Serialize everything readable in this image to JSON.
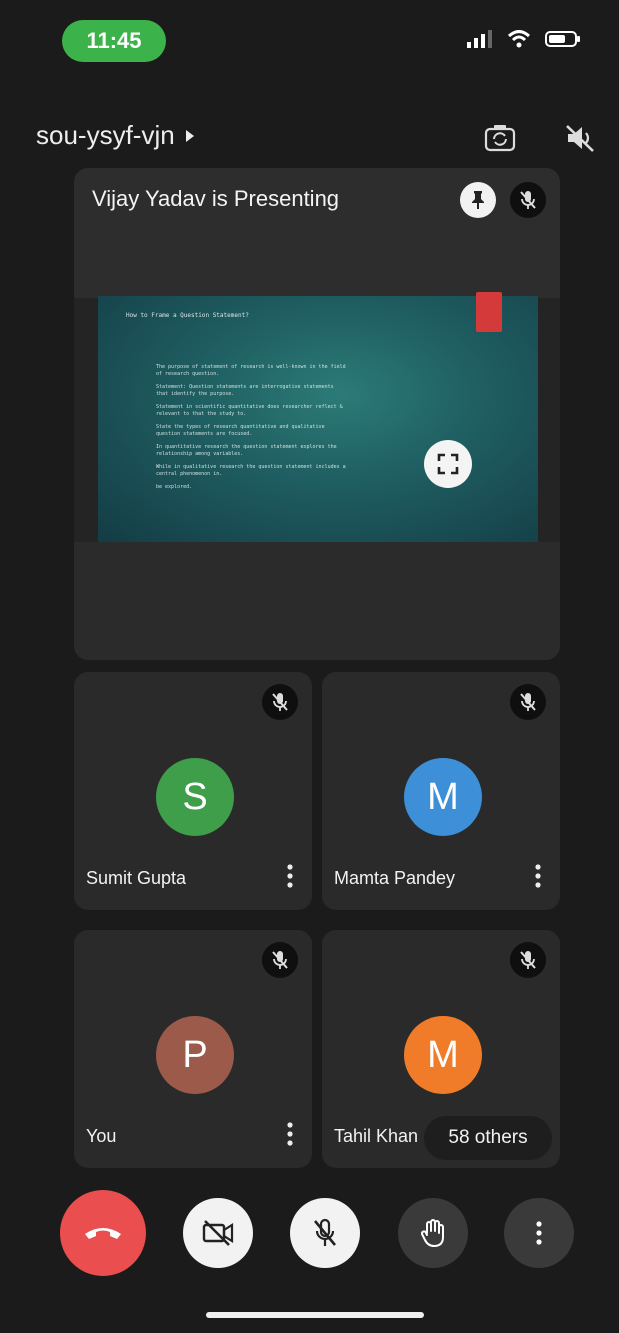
{
  "status": {
    "time": "11:45",
    "time_pill_color": "#3cb34a"
  },
  "header": {
    "meeting_code": "sou-ysyf-vjn",
    "icons": [
      "switch-camera-icon",
      "speaker-off-icon"
    ]
  },
  "presentation": {
    "title": "Vijay Yadav is Presenting",
    "icons": [
      "pin-icon",
      "mic-off-icon",
      "fullscreen-icon"
    ],
    "slide": {
      "heading": "How to Frame a Question Statement?",
      "lines": [
        "The purpose of statement of research is well-known in the field of research question.",
        "Statement: Question statements are interrogative statements that identify the purpose.",
        "Statement in scientific quantitative does researcher reflect & relevant to that the study to.",
        "State the types of research quantitative and qualitative question statements are focused.",
        "In quantitative research the question statement explores the relationship among variables.",
        "While in qualitative research the question statement includes a central phenomenon in.",
        "be explored."
      ]
    }
  },
  "participants": [
    {
      "name": "Sumit Gupta",
      "initial": "S",
      "color": "#3e9e4a"
    },
    {
      "name": "Mamta Pandey",
      "initial": "M",
      "color": "#3d8fd8"
    },
    {
      "name": "You",
      "initial": "P",
      "color": "#9c5a4a"
    },
    {
      "name": "Tahil Khan",
      "initial": "M",
      "color": "#f07c2a"
    }
  ],
  "others_label": "58 others",
  "controls": {
    "end_call_color": "#ea4e4e",
    "icons": [
      "end-call-icon",
      "camera-off-icon",
      "mic-off-icon",
      "raise-hand-icon",
      "more-options-icon"
    ]
  }
}
